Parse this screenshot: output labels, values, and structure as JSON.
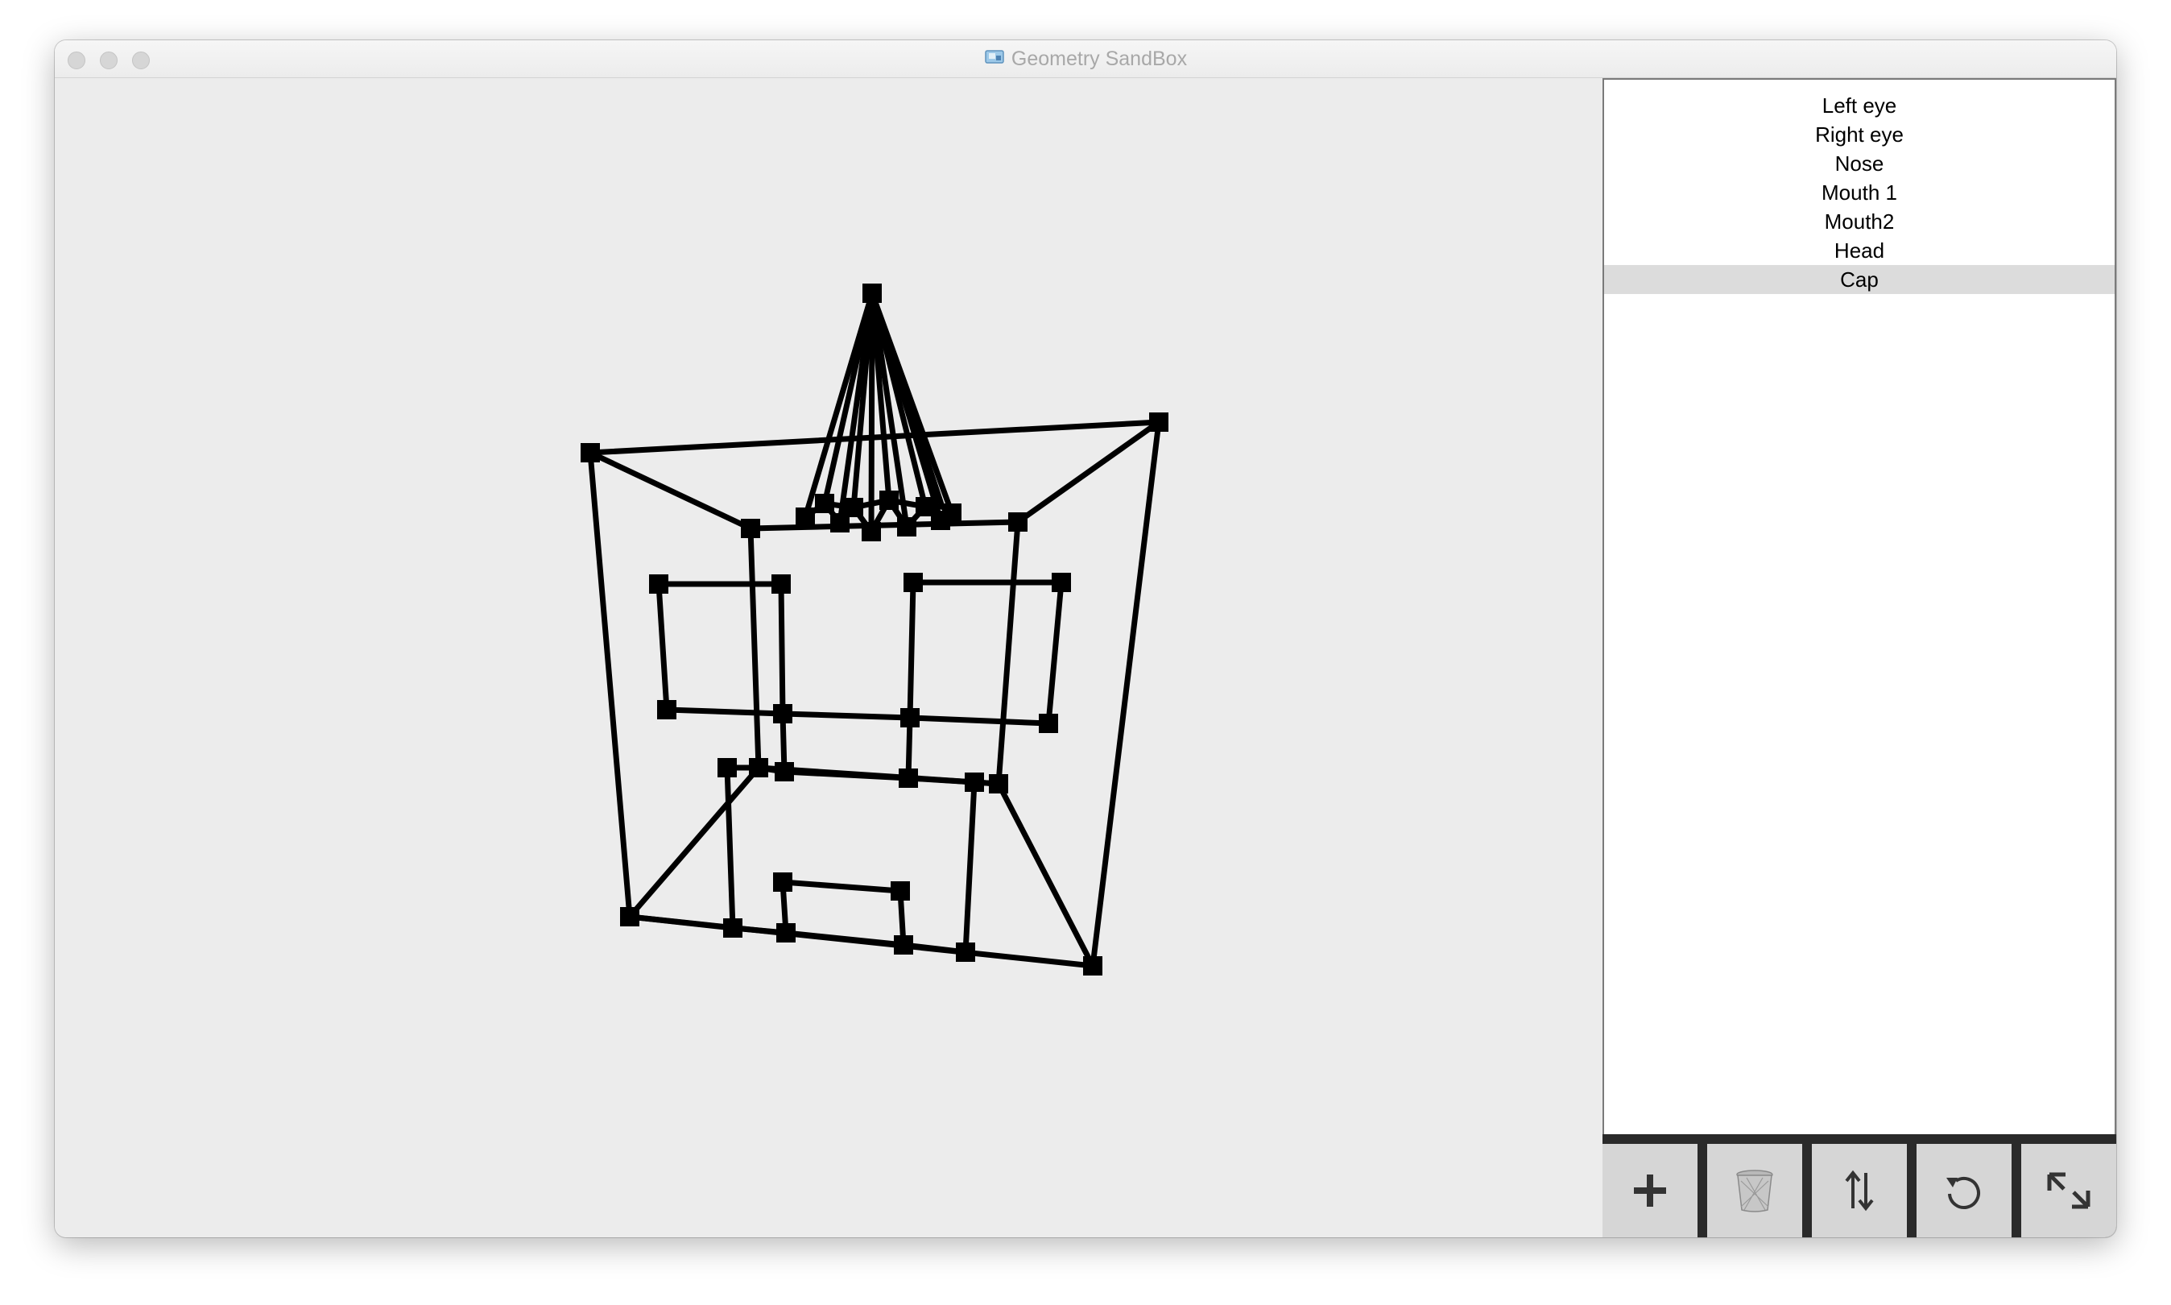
{
  "window": {
    "title": "Geometry SandBox",
    "app_icon": "geometry-cube-icon"
  },
  "sidebar": {
    "items": [
      {
        "label": "Left eye",
        "selected": false
      },
      {
        "label": "Right eye",
        "selected": false
      },
      {
        "label": "Nose",
        "selected": false
      },
      {
        "label": "Mouth 1",
        "selected": false
      },
      {
        "label": "Mouth2",
        "selected": false
      },
      {
        "label": "Head",
        "selected": false
      },
      {
        "label": "Cap",
        "selected": true
      }
    ]
  },
  "toolbar": {
    "buttons": [
      {
        "icon": "plus-icon",
        "action": "add"
      },
      {
        "icon": "trash-icon",
        "action": "delete"
      },
      {
        "icon": "swap-vertical-icon",
        "action": "reorder"
      },
      {
        "icon": "rotate-icon",
        "action": "rotate"
      },
      {
        "icon": "resize-icon",
        "action": "scale"
      }
    ]
  },
  "colors": {
    "canvas_bg": "#ececec",
    "wire": "#000000",
    "selection": "#dcdcdc",
    "toolbar_bg": "#2a2a2a",
    "button_bg": "#d6d6d6"
  }
}
